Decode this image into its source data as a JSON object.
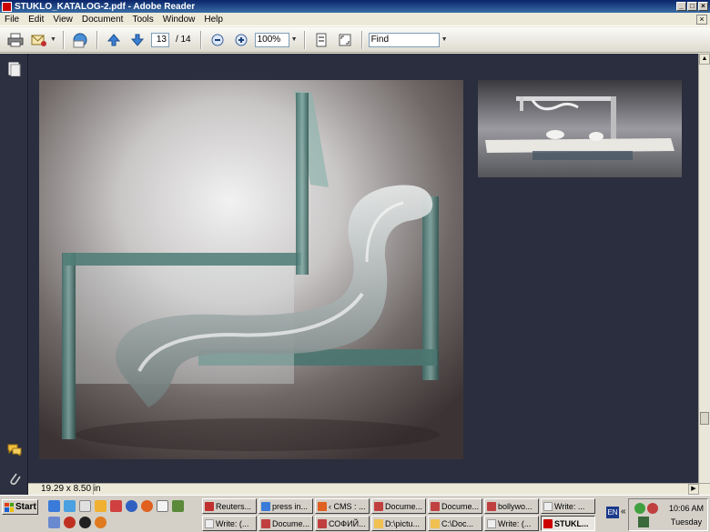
{
  "window": {
    "title": "STUKLO_KATALOG-2.pdf - Adobe Reader"
  },
  "menu": [
    "File",
    "Edit",
    "View",
    "Document",
    "Tools",
    "Window",
    "Help"
  ],
  "toolbar": {
    "page_current": "13",
    "page_total": "/ 14",
    "zoom": "100%",
    "find_placeholder": "Find"
  },
  "status": {
    "page_size": "19.29 x 8.50 in"
  },
  "taskbar": {
    "start_label": "Start",
    "tasks_row1": [
      "Reuters...",
      "press in...",
      "‹ CMS : ...",
      "Docume...",
      "Docume...",
      "bollywo...",
      "Write: ..."
    ],
    "tasks_row2": [
      "Write: (...",
      "Docume...",
      "СОФИЙ...",
      "D:\\pictu...",
      "C:\\Doc...",
      "Write: (...",
      "STUKL..."
    ],
    "lang": "EN",
    "time": "10:06 AM",
    "day": "Tuesday"
  },
  "colors": {
    "titlebar": "#0a246a",
    "doc_bg": "#2a2e3e",
    "nav_bg": "#2c3040"
  }
}
